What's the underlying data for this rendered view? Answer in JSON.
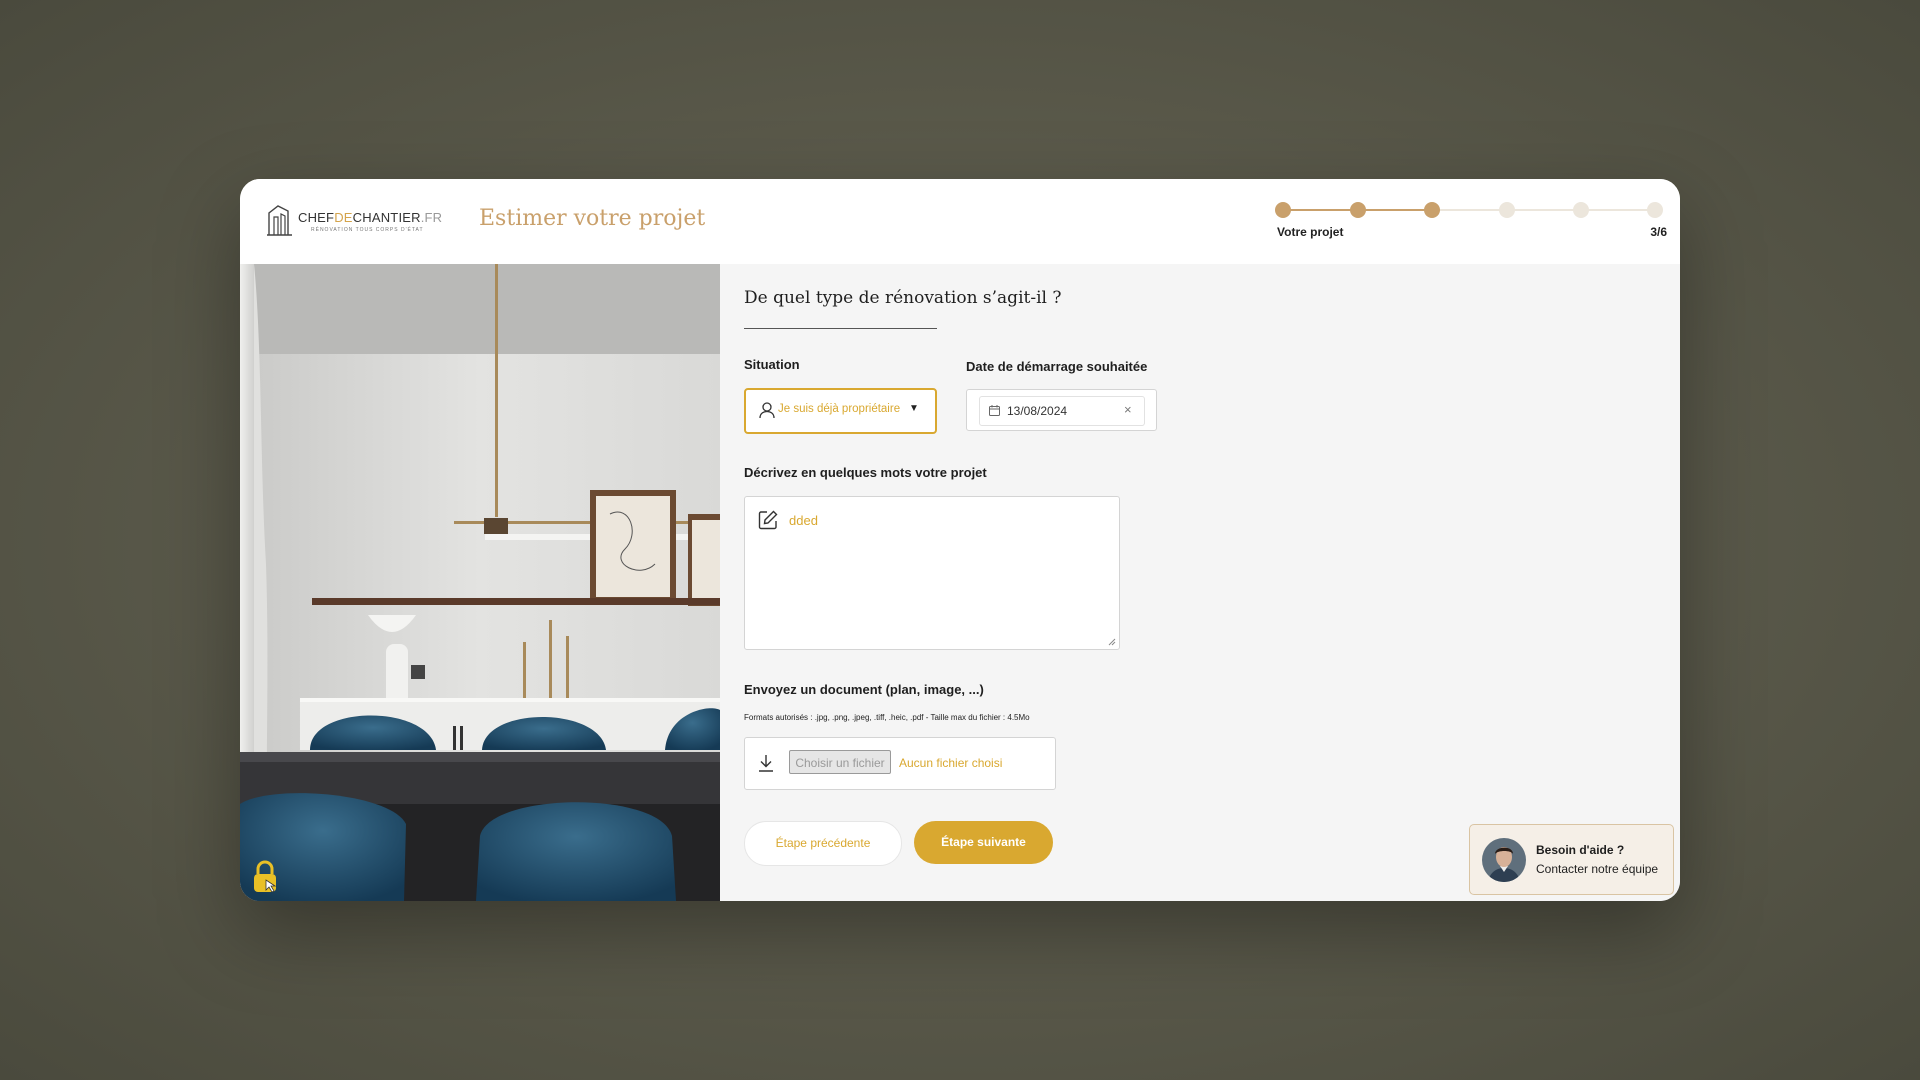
{
  "header": {
    "logo": {
      "part1": "CHEF",
      "part2": "DE",
      "part3": "CHANTIER",
      "part4": ".FR",
      "tagline": "RÉNOVATION TOUS CORPS D'ÉTAT"
    },
    "title": "Estimer votre projet",
    "stepper": {
      "current_label": "Votre projet",
      "count": "3/6",
      "current": 3,
      "total": 6,
      "active_color": "#c9a06b",
      "inactive_color": "#ece6dc"
    }
  },
  "form": {
    "question": "De quel type de rénovation s’agit-il ?",
    "situation": {
      "label": "Situation",
      "value": "Je suis déjà propriétaire",
      "icon": "user-icon"
    },
    "start_date": {
      "label": "Date de démarrage souhaitée",
      "value": "13/08/2024",
      "icon": "calendar-icon",
      "clear": "×"
    },
    "description": {
      "label": "Décrivez en quelques mots votre projet",
      "value": "dded",
      "icon": "edit-icon"
    },
    "document": {
      "label": "Envoyez un document (plan, image, ...)",
      "formats": "Formats autorisés : .jpg, .png, .jpeg, .tiff, .heic, .pdf - Taille max du fichier : 4.5Mo",
      "button": "Choisir un fichier",
      "status": "Aucun fichier choisi",
      "icon": "download-icon"
    },
    "buttons": {
      "previous": "Étape précédente",
      "next": "Étape suivante"
    }
  },
  "help": {
    "title": "Besoin d'aide ?",
    "subtitle": "Contacter notre équipe"
  },
  "colors": {
    "accent": "#d9a830",
    "title_gold": "#c9a06b",
    "panel_bg": "#f5f5f5",
    "help_bg": "#f5efe7"
  }
}
